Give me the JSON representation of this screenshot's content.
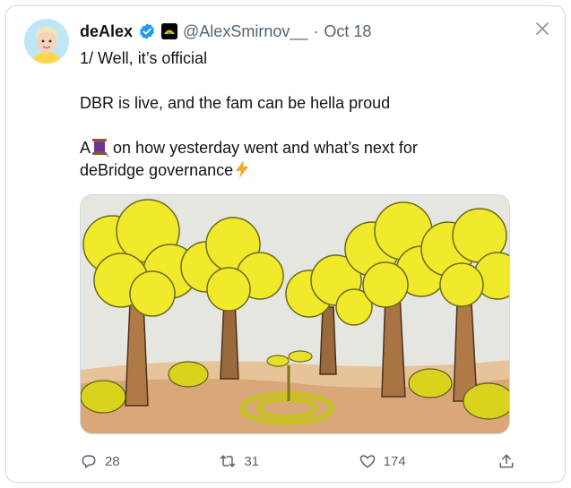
{
  "tweet": {
    "display_name": "deAlex",
    "handle": "@AlexSmirnov__",
    "separator": "·",
    "date": "Oct 18",
    "body": {
      "line1": "1/ Well, it’s official",
      "line2": "DBR is live, and the fam can be hella proud",
      "line3_prefix": "A",
      "line3_rest": "on how yesterday went and what’s next for",
      "line4": "deBridge governance"
    },
    "media": {
      "description_icon": "forest-illustration"
    }
  },
  "actions": {
    "replies": "28",
    "retweets": "31",
    "likes": "174"
  },
  "colors": {
    "verified": "#1d9bf0",
    "muted": "#536471",
    "border": "#cfd9de"
  }
}
